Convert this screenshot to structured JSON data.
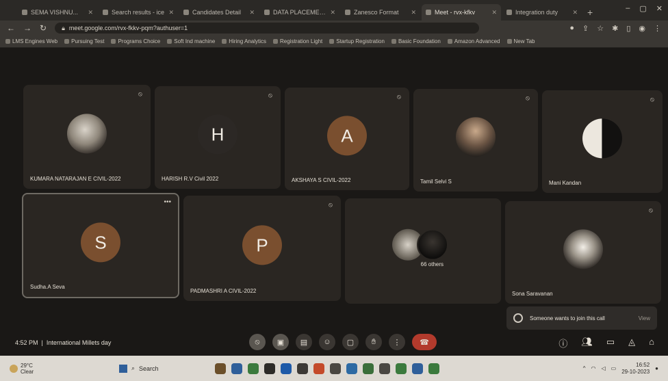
{
  "browser": {
    "tabs": [
      {
        "label": "SEMA VISHNU..."
      },
      {
        "label": "Search results - ice"
      },
      {
        "label": "Candidates Detail"
      },
      {
        "label": "DATA PLACEMENT"
      },
      {
        "label": "Zanesco Format"
      },
      {
        "label": "Meet - rvx-kfkv"
      },
      {
        "label": "Integration duty"
      }
    ],
    "url": "meet.google.com/rvx-fkkv-pqm?authuser=1",
    "bookmarks": [
      "LMS Engines Web",
      "Pursuing Test",
      "Programs Choice",
      "Soft Ind machine",
      "Hiring Analytics",
      "Registration Light",
      "Startup Registration",
      "Basic Foundation",
      "Amazon Advanced",
      "New Tab"
    ]
  },
  "participants": [
    {
      "name": "KUMARA NATARAJAN E CIVIL-2022",
      "initial": ""
    },
    {
      "name": "HARISH R.V Civil 2022",
      "initial": "H"
    },
    {
      "name": "AKSHAYA S CIVIL-2022",
      "initial": "A"
    },
    {
      "name": "Tamil Selvi S",
      "initial": ""
    },
    {
      "name": "Mani Kandan",
      "initial": ""
    },
    {
      "name": "Sudha.A Seva",
      "initial": "S"
    },
    {
      "name": "PADMASHRI A CIVIL-2022",
      "initial": "P"
    },
    {
      "name": "66 others",
      "initial": ""
    },
    {
      "name": "Sona Saravanan",
      "initial": ""
    }
  ],
  "notification": {
    "text": "Someone wants to join this call",
    "action": "View"
  },
  "meeting": {
    "time": "4:52 PM",
    "title": "International Millets day"
  },
  "controls": {
    "icons": [
      "mic-off-icon",
      "camera-off-icon",
      "captions-icon",
      "emoji-icon",
      "present-icon",
      "raise-hand-icon",
      "more-icon",
      "end-call-icon"
    ],
    "right_icons": [
      "info-icon",
      "people-icon",
      "chat-icon",
      "activities-icon",
      "lock-icon"
    ]
  },
  "taskbar": {
    "weather_temp": "29°C",
    "weather_desc": "Clear",
    "search_label": "Search",
    "clock_time": "16:52",
    "clock_date": "29-10-2023"
  }
}
